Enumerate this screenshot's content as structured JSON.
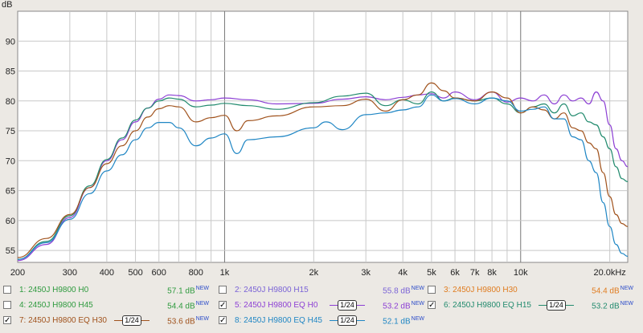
{
  "chart_data": {
    "type": "line",
    "ylabel": "dB",
    "xlabel": "",
    "xscale": "log",
    "xlim": [
      200,
      23000
    ],
    "ylim": [
      53,
      95
    ],
    "grid": true,
    "x_ticks": [
      {
        "v": 200,
        "t": "200"
      },
      {
        "v": 300,
        "t": "300"
      },
      {
        "v": 400,
        "t": "400"
      },
      {
        "v": 500,
        "t": "500"
      },
      {
        "v": 600,
        "t": "600"
      },
      {
        "v": 800,
        "t": "800"
      },
      {
        "v": 1000,
        "t": "1k"
      },
      {
        "v": 2000,
        "t": "2k"
      },
      {
        "v": 3000,
        "t": "3k"
      },
      {
        "v": 4000,
        "t": "4k"
      },
      {
        "v": 5000,
        "t": "5k"
      },
      {
        "v": 6000,
        "t": "6k"
      },
      {
        "v": 7000,
        "t": "7k"
      },
      {
        "v": 8000,
        "t": "8k"
      },
      {
        "v": 10000,
        "t": "10k"
      },
      {
        "v": 20000,
        "t": "20.0kHz"
      }
    ],
    "y_ticks": [
      55,
      60,
      65,
      70,
      75,
      80,
      85,
      90
    ],
    "series": [
      {
        "name": "5: 2450J H9800 EQ H0",
        "color": "#8c3fd4",
        "points": [
          [
            200,
            53.3
          ],
          [
            250,
            56
          ],
          [
            300,
            60.5
          ],
          [
            350,
            65.5
          ],
          [
            400,
            70
          ],
          [
            450,
            73.5
          ],
          [
            500,
            76.5
          ],
          [
            550,
            78.8
          ],
          [
            600,
            80.3
          ],
          [
            650,
            81
          ],
          [
            700,
            80.9
          ],
          [
            800,
            80
          ],
          [
            900,
            80.2
          ],
          [
            1000,
            80.5
          ],
          [
            1200,
            80.2
          ],
          [
            1500,
            79.5
          ],
          [
            2000,
            79.6
          ],
          [
            2500,
            80.3
          ],
          [
            3000,
            80.7
          ],
          [
            3500,
            80.2
          ],
          [
            4000,
            80.6
          ],
          [
            4500,
            81
          ],
          [
            5000,
            81.2
          ],
          [
            5500,
            80.5
          ],
          [
            6000,
            81.5
          ],
          [
            7000,
            80.2
          ],
          [
            8000,
            81.5
          ],
          [
            9000,
            79.8
          ],
          [
            10000,
            80.5
          ],
          [
            11000,
            80
          ],
          [
            12000,
            81
          ],
          [
            13000,
            79.5
          ],
          [
            14000,
            81
          ],
          [
            15000,
            80
          ],
          [
            16000,
            80.5
          ],
          [
            17000,
            79.5
          ],
          [
            18000,
            81.5
          ],
          [
            19000,
            80
          ],
          [
            20000,
            76
          ],
          [
            21000,
            72
          ],
          [
            22000,
            70
          ],
          [
            23000,
            69
          ]
        ]
      },
      {
        "name": "6: 2450J H9800 EQ H15",
        "color": "#228b6e",
        "points": [
          [
            200,
            53.5
          ],
          [
            250,
            56.5
          ],
          [
            300,
            60.8
          ],
          [
            350,
            65.8
          ],
          [
            400,
            70.2
          ],
          [
            450,
            73.8
          ],
          [
            500,
            76.8
          ],
          [
            550,
            78.8
          ],
          [
            600,
            80
          ],
          [
            650,
            80.5
          ],
          [
            700,
            80.3
          ],
          [
            800,
            79
          ],
          [
            900,
            79.3
          ],
          [
            1000,
            79.6
          ],
          [
            1200,
            79.2
          ],
          [
            1500,
            78.6
          ],
          [
            2000,
            79.7
          ],
          [
            2500,
            80.8
          ],
          [
            3000,
            81.3
          ],
          [
            3500,
            79.2
          ],
          [
            4000,
            80.2
          ],
          [
            4500,
            79.5
          ],
          [
            5000,
            81.5
          ],
          [
            5500,
            80
          ],
          [
            6000,
            80.5
          ],
          [
            7000,
            80
          ],
          [
            8000,
            80.5
          ],
          [
            9000,
            79.5
          ],
          [
            10000,
            78
          ],
          [
            11000,
            79
          ],
          [
            12000,
            79.5
          ],
          [
            13000,
            78
          ],
          [
            14000,
            79.5
          ],
          [
            15000,
            77.5
          ],
          [
            16000,
            78
          ],
          [
            17000,
            76.5
          ],
          [
            18000,
            76
          ],
          [
            19000,
            74
          ],
          [
            20000,
            72
          ],
          [
            21000,
            69
          ],
          [
            22000,
            67
          ],
          [
            23000,
            66.5
          ]
        ]
      },
      {
        "name": "7: 2450J H9800 EQ H30",
        "color": "#a0521c",
        "points": [
          [
            200,
            53.8
          ],
          [
            250,
            57
          ],
          [
            300,
            61
          ],
          [
            350,
            65.5
          ],
          [
            400,
            69.5
          ],
          [
            450,
            72.5
          ],
          [
            500,
            75
          ],
          [
            550,
            77.3
          ],
          [
            600,
            78.7
          ],
          [
            650,
            79.2
          ],
          [
            700,
            79
          ],
          [
            800,
            76.5
          ],
          [
            900,
            77.2
          ],
          [
            1000,
            77.6
          ],
          [
            1100,
            75
          ],
          [
            1200,
            76.7
          ],
          [
            1500,
            77.5
          ],
          [
            2000,
            79
          ],
          [
            2500,
            79.2
          ],
          [
            3000,
            80.3
          ],
          [
            3500,
            78.3
          ],
          [
            4000,
            80.2
          ],
          [
            4500,
            81
          ],
          [
            5000,
            83
          ],
          [
            5500,
            81.7
          ],
          [
            6000,
            80.5
          ],
          [
            7000,
            80
          ],
          [
            8000,
            81.5
          ],
          [
            9000,
            80.5
          ],
          [
            10000,
            78
          ],
          [
            11000,
            79
          ],
          [
            12000,
            78.5
          ],
          [
            13000,
            77
          ],
          [
            14000,
            78
          ],
          [
            15000,
            75.5
          ],
          [
            16000,
            75
          ],
          [
            17000,
            73
          ],
          [
            18000,
            72
          ],
          [
            19000,
            68
          ],
          [
            20000,
            64
          ],
          [
            21000,
            61
          ],
          [
            22000,
            59.5
          ],
          [
            23000,
            59
          ]
        ]
      },
      {
        "name": "8: 2450J H9800 EQ H45",
        "color": "#1f86c4",
        "points": [
          [
            200,
            53.5
          ],
          [
            250,
            56.3
          ],
          [
            300,
            60.2
          ],
          [
            350,
            64.5
          ],
          [
            400,
            68.3
          ],
          [
            450,
            71
          ],
          [
            500,
            73.5
          ],
          [
            550,
            75.5
          ],
          [
            600,
            76.4
          ],
          [
            650,
            76.4
          ],
          [
            700,
            75.5
          ],
          [
            800,
            72.5
          ],
          [
            900,
            73.8
          ],
          [
            1000,
            74.5
          ],
          [
            1100,
            71.2
          ],
          [
            1200,
            73.5
          ],
          [
            1500,
            74
          ],
          [
            2000,
            75.5
          ],
          [
            2200,
            76.5
          ],
          [
            2500,
            75.2
          ],
          [
            3000,
            77.7
          ],
          [
            3500,
            78
          ],
          [
            4000,
            78.5
          ],
          [
            4500,
            79
          ],
          [
            5000,
            81
          ],
          [
            5500,
            80
          ],
          [
            6000,
            80.4
          ],
          [
            7000,
            79.5
          ],
          [
            8000,
            80.5
          ],
          [
            9000,
            80
          ],
          [
            10000,
            78.3
          ],
          [
            11000,
            78.6
          ],
          [
            12000,
            79
          ],
          [
            13000,
            77
          ],
          [
            14000,
            77
          ],
          [
            15000,
            74
          ],
          [
            16000,
            73.5
          ],
          [
            17000,
            70
          ],
          [
            18000,
            68
          ],
          [
            19000,
            63
          ],
          [
            20000,
            59
          ],
          [
            21000,
            56
          ],
          [
            22000,
            54.5
          ],
          [
            23000,
            54
          ]
        ]
      }
    ]
  },
  "legend": [
    {
      "index": 1,
      "label": "1: 2450J H9800 H0",
      "db": "57.1 dB",
      "badge": "NEW",
      "checked": false,
      "smoothing": "",
      "color": "#2e9a3e"
    },
    {
      "index": 2,
      "label": "2: 2450J H9800 H15",
      "db": "55.8 dB",
      "badge": "NEW",
      "checked": false,
      "smoothing": "",
      "color": "#7a63d6"
    },
    {
      "index": 3,
      "label": "3: 2450J H9800 H30",
      "db": "54.4 dB",
      "badge": "NEW",
      "checked": false,
      "smoothing": "",
      "color": "#e07c1f"
    },
    {
      "index": 4,
      "label": "4: 2450J H9800 H45",
      "db": "54.4 dB",
      "badge": "NEW",
      "checked": false,
      "smoothing": "",
      "color": "#2e9a3e"
    },
    {
      "index": 5,
      "label": "5: 2450J H9800 EQ H0",
      "db": "53.2 dB",
      "badge": "NEW",
      "checked": true,
      "smoothing": "1/24",
      "color": "#8c3fd4"
    },
    {
      "index": 6,
      "label": "6: 2450J H9800 EQ H15",
      "db": "53.2 dB",
      "badge": "NEW",
      "checked": true,
      "smoothing": "1/24",
      "color": "#228b6e"
    },
    {
      "index": 7,
      "label": "7: 2450J H9800 EQ H30",
      "db": "53.6 dB",
      "badge": "NEW",
      "checked": true,
      "smoothing": "1/24",
      "color": "#a0521c"
    },
    {
      "index": 8,
      "label": "8: 2450J H9800 EQ H45",
      "db": "52.1 dB",
      "badge": "NEW",
      "checked": true,
      "smoothing": "1/24",
      "color": "#1f86c4"
    }
  ],
  "check_mark": "✓"
}
